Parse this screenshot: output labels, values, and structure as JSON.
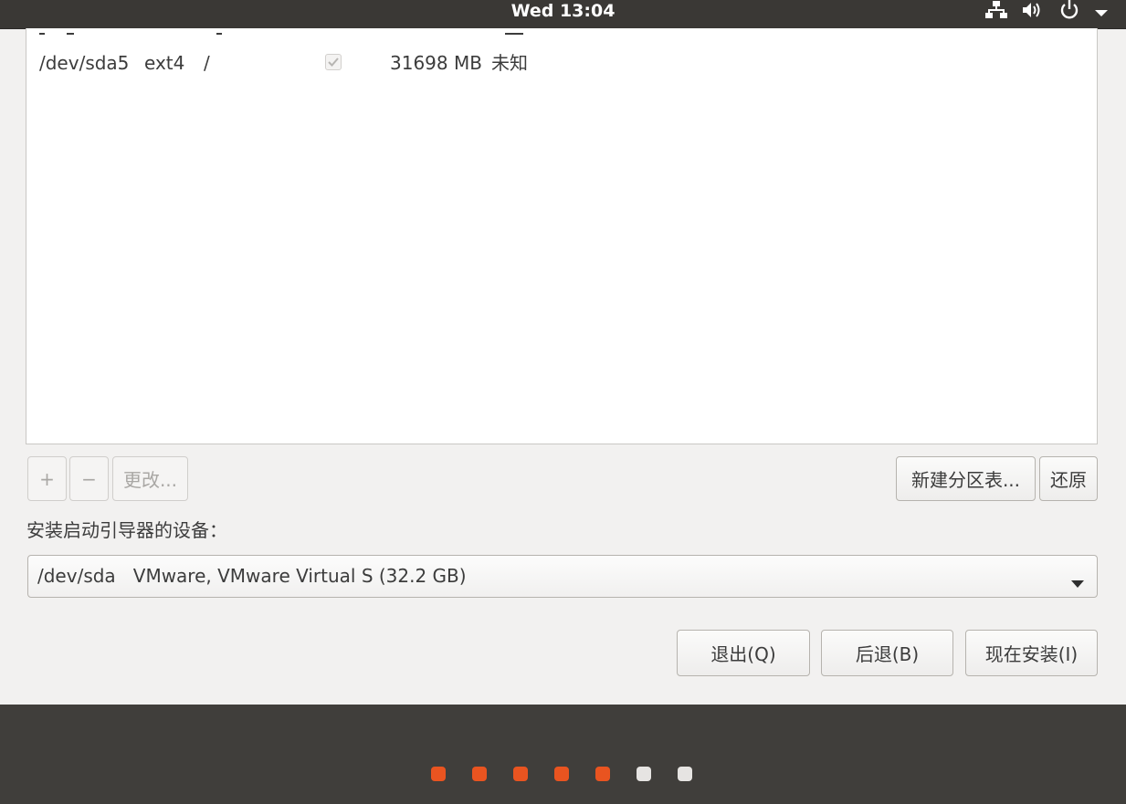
{
  "topbar": {
    "clock": "Wed 13:04",
    "icons": [
      "network-icon",
      "volume-icon",
      "power-icon",
      "menu-down-icon"
    ]
  },
  "partitions": {
    "rows": [
      {
        "device": "/dev/sda5",
        "type": "ext4",
        "mount": "/",
        "format_checked": true,
        "size": "31698 MB",
        "used": "未知"
      }
    ]
  },
  "partition_toolbar": {
    "add_label": "+",
    "remove_label": "−",
    "change_label": "更改...",
    "new_table_label": "新建分区表...",
    "revert_label": "还原"
  },
  "bootloader": {
    "label": "安装启动引导器的设备：",
    "selected": "/dev/sda   VMware, VMware Virtual S (32.2 GB)"
  },
  "actions": {
    "quit_label": "退出(Q)",
    "back_label": "后退(B)",
    "install_label": "现在安装(I)"
  },
  "progress": {
    "total_steps": 7,
    "completed_steps": 5,
    "active_color": "#e95420",
    "inactive_color": "#e6e4e2"
  },
  "colors": {
    "topbar": "#3a3835",
    "bottombar": "#403e3b",
    "window_bg": "#f2f1f0"
  }
}
